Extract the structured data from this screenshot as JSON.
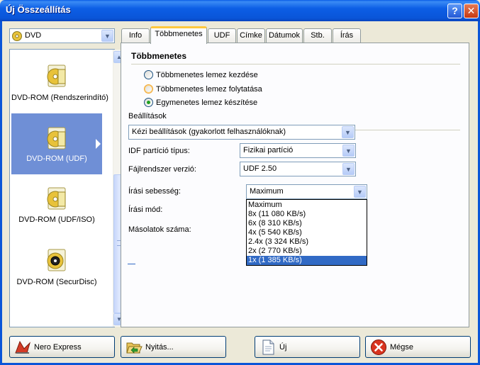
{
  "window": {
    "title": "Új Összeállítás",
    "help_label": "?",
    "close_label": "✕"
  },
  "disc_type": {
    "selected": "DVD",
    "icon": "dvd-disc-icon"
  },
  "compilation_list": {
    "items": [
      {
        "label": "DVD-ROM (Rendszerindító)",
        "icon": "dvd-boot-icon"
      },
      {
        "label": "DVD-ROM (UDF)",
        "icon": "dvd-udf-icon",
        "selected": true
      },
      {
        "label": "DVD-ROM (UDF/ISO)",
        "icon": "dvd-udf-iso-icon"
      },
      {
        "label": "DVD-ROM (SecurDisc)",
        "icon": "dvd-securdisc-icon"
      }
    ],
    "securdisc_badge": "SecurDisc"
  },
  "tabs": [
    {
      "label": "Info"
    },
    {
      "label": "Többmenetes",
      "active": true
    },
    {
      "label": "UDF"
    },
    {
      "label": "Címke"
    },
    {
      "label": "Dátumok"
    },
    {
      "label": "Stb."
    },
    {
      "label": "Írás"
    }
  ],
  "multisession": {
    "section_title": "Többmenetes",
    "options": [
      {
        "label": "Többmenetes lemez kezdése",
        "checked": false
      },
      {
        "label": "Többmenetes lemez folytatása",
        "checked": false,
        "hover": true
      },
      {
        "label": "Egymenetes lemez készítése",
        "checked": true
      }
    ]
  },
  "settings": {
    "group_title": "Beállítások",
    "preset_value": "Kézi beállítások (gyakorlott felhasználóknak)",
    "idf_label": "IDF partíció típus:",
    "idf_value": "Fizikai partíció",
    "fs_label": "Fájlrendszer verzió:",
    "fs_value": "UDF 2.50",
    "speed_label": "Írási sebesség:",
    "speed_value": "Maximum",
    "mode_label": "Írási mód:",
    "copies_label": "Másolatok száma:"
  },
  "speed_dropdown": {
    "options": [
      {
        "label": "Maximum"
      },
      {
        "label": "8x (11 080 KB/s)"
      },
      {
        "label": "6x (8 310 KB/s)"
      },
      {
        "label": "4x (5 540 KB/s)"
      },
      {
        "label": "2.4x (3 324 KB/s)"
      },
      {
        "label": "2x (2 770 KB/s)"
      },
      {
        "label": "1x (1 385 KB/s)",
        "selected": true
      }
    ]
  },
  "buttons": {
    "nero_express": "Nero Express",
    "open": "Nyitás...",
    "new": "Új",
    "cancel": "Mégse"
  },
  "colors": {
    "titlebar": "#0a55d8",
    "selection": "#316ac5",
    "list_selection": "#6f8fd6",
    "active_tab_accent": "#ffc83c"
  }
}
